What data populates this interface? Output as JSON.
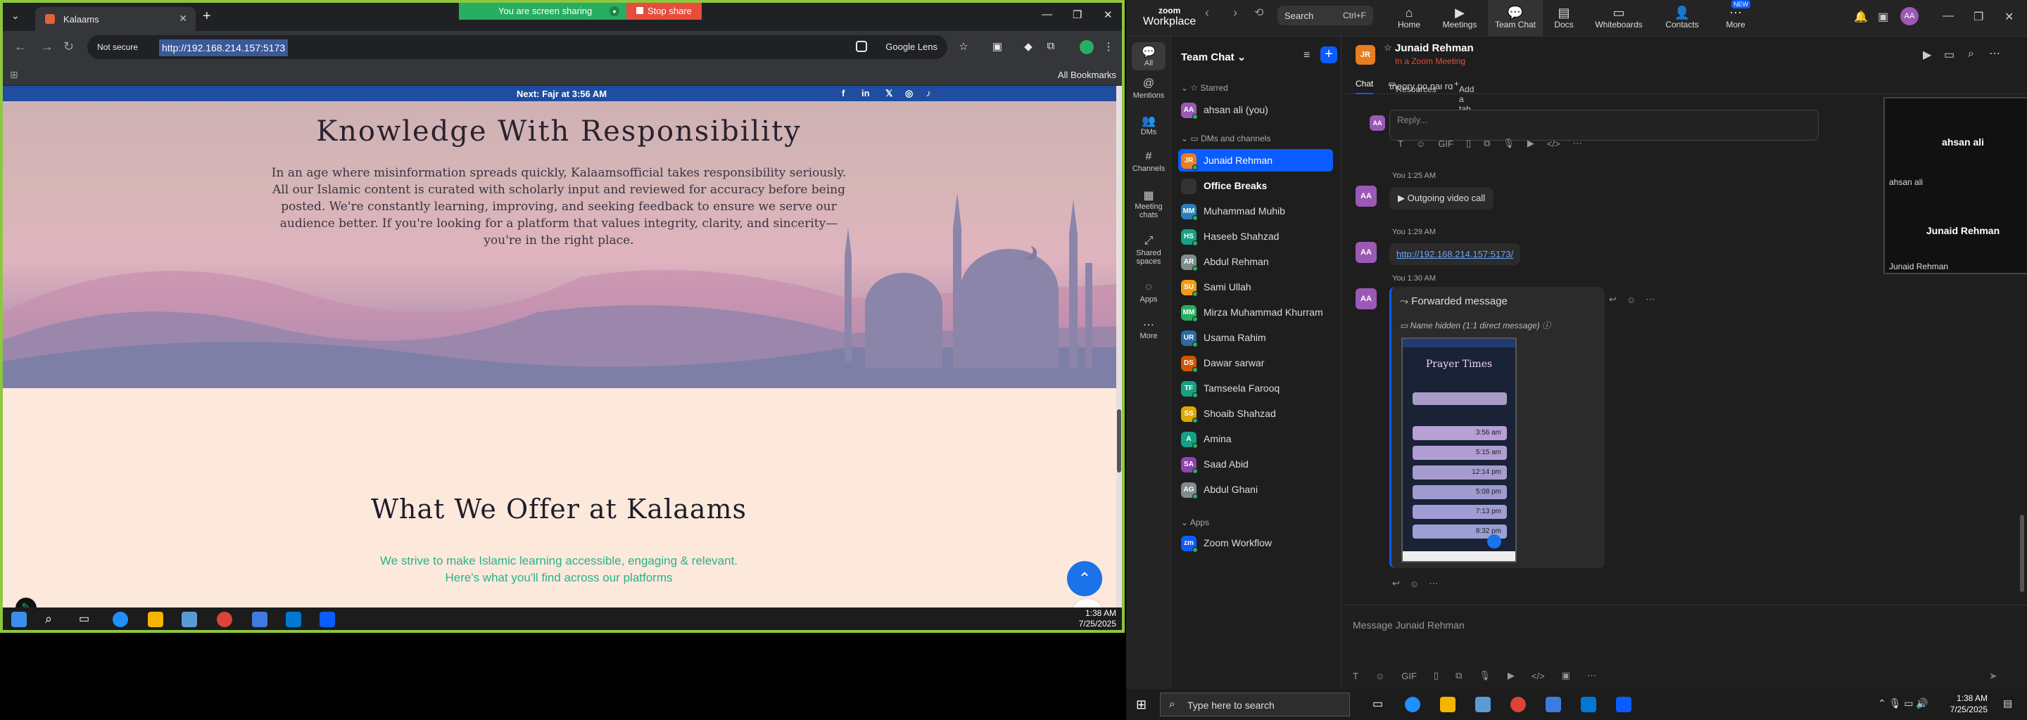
{
  "share_banner": {
    "sharing": "You are screen sharing",
    "stop": "Stop share"
  },
  "browser": {
    "tab_title": "Kalaams",
    "security": "Not secure",
    "url": "http://192.168.214.157:5173",
    "lens": "Google Lens",
    "all_bookmarks": "All Bookmarks"
  },
  "site": {
    "next_prayer": "Next: Fajr at 3:56 AM",
    "hero_title": "Knowledge With Responsibility",
    "hero_text": "In an age where misinformation spreads quickly, Kalaamsofficial takes responsibility seriously. All our Islamic content is curated with scholarly input and reviewed for accuracy before being posted. We're constantly learning, improving, and seeking feedback to ensure we serve our audience better. If you're looking for a platform that values integrity, clarity, and sincerity—you're in the right place.",
    "offer_title": "What We Offer at Kalaams",
    "offer_sub1": "We strive to make Islamic learning accessible, engaging & relevant.",
    "offer_sub2": "Here's what you'll find across our platforms"
  },
  "share_taskbar": {
    "time": "1:38 AM",
    "date": "7/25/2025"
  },
  "zoom": {
    "logo_top": "zoom",
    "logo_bottom": "Workplace",
    "search": "Search",
    "search_key": "Ctrl+F",
    "tabs": [
      {
        "label": "Home"
      },
      {
        "label": "Meetings"
      },
      {
        "label": "Team Chat"
      },
      {
        "label": "Docs"
      },
      {
        "label": "Whiteboards"
      },
      {
        "label": "Contacts"
      },
      {
        "label": "More",
        "badge": "NEW"
      }
    ],
    "user_avatar": "AA",
    "sidebar": [
      "All",
      "Mentions",
      "DMs",
      "Channels",
      "Meeting chats",
      "Shared spaces",
      "Apps",
      "More"
    ],
    "list_header": "Team Chat",
    "sec_starred": "Starred",
    "sec_dms": "DMs and channels",
    "sec_apps": "Apps",
    "starred": [
      {
        "initials": "AA",
        "name": "ahsan ali (you)",
        "color": "#9b59b6"
      }
    ],
    "contacts": [
      {
        "initials": "JR",
        "name": "Junaid Rehman",
        "color": "#e67e22"
      },
      {
        "initials": "",
        "name": "Office Breaks",
        "color": "#333"
      },
      {
        "initials": "MM",
        "name": "Muhammad Muhib",
        "color": "#2980b9"
      },
      {
        "initials": "HS",
        "name": "Haseeb Shahzad",
        "color": "#16a085"
      },
      {
        "initials": "AR",
        "name": "Abdul Rehman",
        "color": "#7f8c8d"
      },
      {
        "initials": "SU",
        "name": "Sami Ullah",
        "color": "#f39c12"
      },
      {
        "initials": "MM",
        "name": "Mirza Muhammad Khurram",
        "color": "#27ae60"
      },
      {
        "initials": "UR",
        "name": "Usama Rahim",
        "color": "#2c6aa0"
      },
      {
        "initials": "DS",
        "name": "Dawar sarwar",
        "color": "#d35400"
      },
      {
        "initials": "TF",
        "name": "Tamseela Farooq",
        "color": "#16a085"
      },
      {
        "initials": "SS",
        "name": "Shoaib Shahzad",
        "color": "#e0a800"
      },
      {
        "initials": "A",
        "name": "Amina",
        "color": "#16a085"
      },
      {
        "initials": "SA",
        "name": "Saad Abid",
        "color": "#8e44ad"
      },
      {
        "initials": "AG",
        "name": "Abdul Ghani",
        "color": "#7f8c8d"
      }
    ],
    "apps": [
      {
        "initials": "zm",
        "name": "Zoom Workflow",
        "color": "#0b5cff"
      }
    ],
    "chat": {
      "avatar": "JR",
      "name": "Junaid Rehman",
      "status": "In a Zoom Meeting",
      "tab_chat": "Chat",
      "tab_resources": "Resources",
      "tab_add": "Add a tab",
      "partial_text": "theory po nai rd",
      "reply_placeholder": "Reply...",
      "msg_avatar": "AA",
      "t1": "You 1:25 AM",
      "call": "Outgoing video call",
      "t2": "You 1:29 AM",
      "link": "http://192.168.214.157:5173/",
      "t3": "You 1:30 AM",
      "forwarded": "Forwarded message",
      "hidden": "Name hidden (1:1 direct message)",
      "compose": "Message Junaid Rehman",
      "pip_name1": "ahsan ali",
      "pip_label1": "ahsan ali",
      "pip_name2": "Junaid Rehman",
      "pip_label2": "Junaid Rehman"
    },
    "phone": {
      "title": "Prayer Times",
      "times": [
        "3:56 am",
        "5:15 am",
        "12:14 pm",
        "5:08 pm",
        "7:13 pm",
        "8:32 pm"
      ]
    }
  },
  "taskbar": {
    "search": "Type here to search",
    "time": "1:38 AM",
    "date": "7/25/2025"
  }
}
